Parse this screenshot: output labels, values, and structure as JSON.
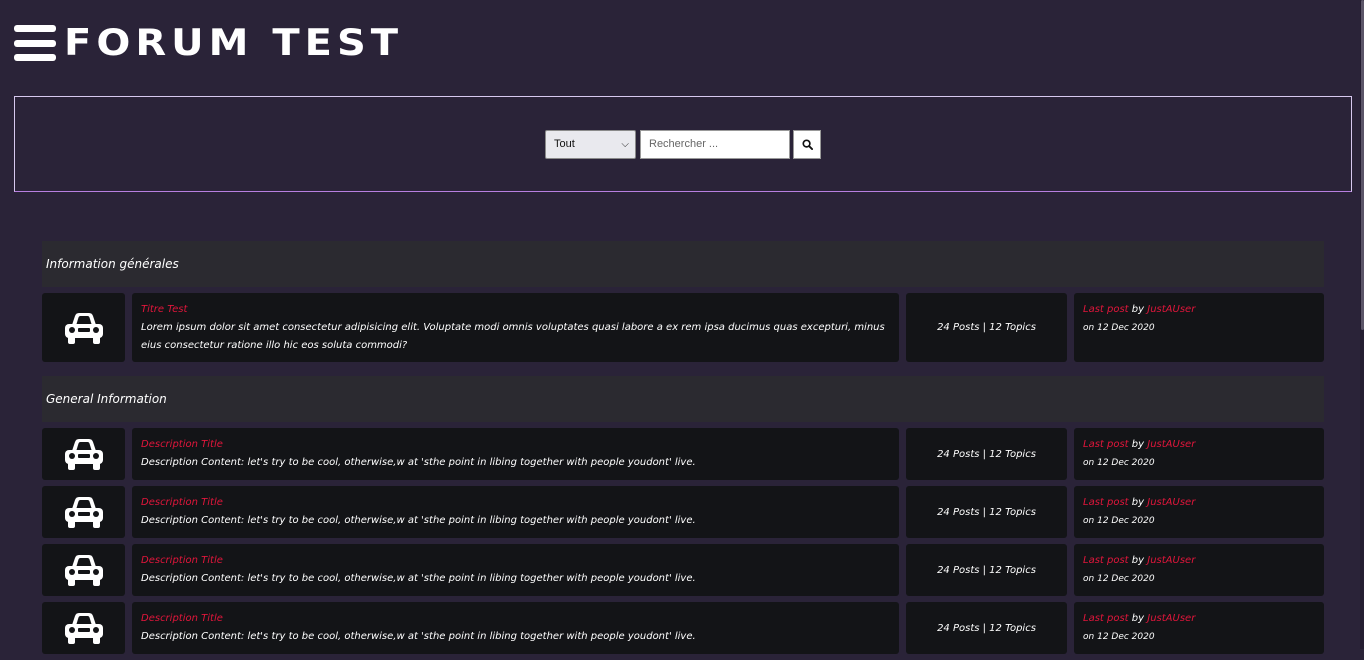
{
  "header": {
    "logo_text": "FORUM TEST"
  },
  "search": {
    "select_value": "Tout",
    "placeholder": "Rechercher ..."
  },
  "sections": [
    {
      "title": "Information générales",
      "rows": [
        {
          "title": "Titre Test",
          "text": "Lorem ipsum dolor sit amet consectetur adipisicing elit. Voluptate modi omnis voluptates quasi labore a ex rem ipsa ducimus quas excepturi, minus eius consectetur ratione illo hic eos soluta commodi?",
          "stats": "24 Posts | 12 Topics",
          "last_post": "Last post",
          "by": "by",
          "user": "JustAUser",
          "on": "on",
          "date": "12 Dec 2020"
        }
      ]
    },
    {
      "title": "General Information",
      "rows": [
        {
          "title": "Description Title",
          "text": "Description Content: let's try to be cool, otherwise,w at 'sthe point in libing together with people youdont' live.",
          "stats": "24 Posts | 12 Topics",
          "last_post": "Last post",
          "by": "by",
          "user": "JustAUser",
          "on": "on",
          "date": "12 Dec 2020"
        },
        {
          "title": "Description Title",
          "text": "Description Content: let's try to be cool, otherwise,w at 'sthe point in libing together with people youdont' live.",
          "stats": "24 Posts | 12 Topics",
          "last_post": "Last post",
          "by": "by",
          "user": "JustAUser",
          "on": "on",
          "date": "12 Dec 2020"
        },
        {
          "title": "Description Title",
          "text": "Description Content: let's try to be cool, otherwise,w at 'sthe point in libing together with people youdont' live.",
          "stats": "24 Posts | 12 Topics",
          "last_post": "Last post",
          "by": "by",
          "user": "JustAUser",
          "on": "on",
          "date": "12 Dec 2020"
        },
        {
          "title": "Description Title",
          "text": "Description Content: let's try to be cool, otherwise,w at 'sthe point in libing together with people youdont' live.",
          "stats": "24 Posts | 12 Topics",
          "last_post": "Last post",
          "by": "by",
          "user": "JustAUser",
          "on": "on",
          "date": "12 Dec 2020"
        }
      ]
    }
  ],
  "icons": {
    "menu": "hamburger-menu-icon",
    "search": "search-icon",
    "row": "car-icon"
  },
  "colors": {
    "background": "#2a2338",
    "accent": "#e0163b",
    "row_bg": "#131417",
    "section_bg": "#2b2a30"
  }
}
